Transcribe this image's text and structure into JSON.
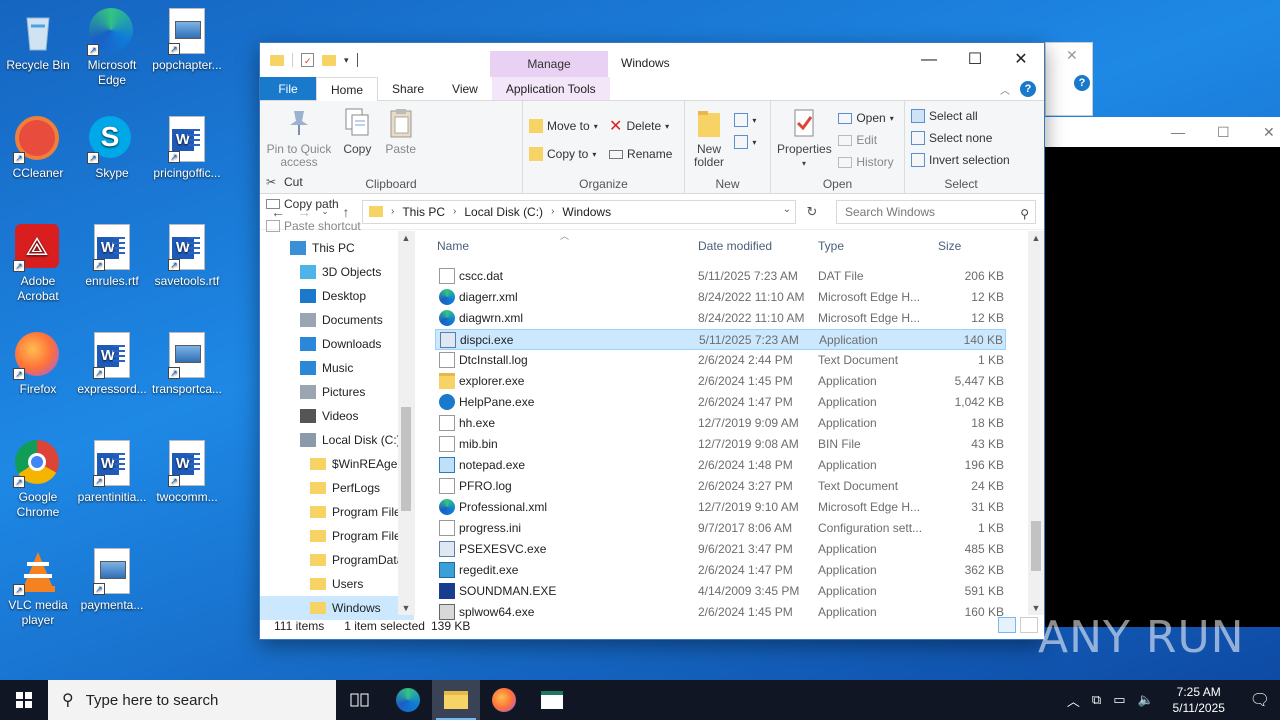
{
  "desktop": {
    "icons": [
      {
        "label": "Recycle Bin"
      },
      {
        "label": "Microsoft Edge"
      },
      {
        "label": "popchapter..."
      },
      {
        "label": "CCleaner"
      },
      {
        "label": "Skype"
      },
      {
        "label": "pricingoffic..."
      },
      {
        "label": "Adobe Acrobat"
      },
      {
        "label": "enrules.rtf"
      },
      {
        "label": "savetools.rtf"
      },
      {
        "label": "Firefox"
      },
      {
        "label": "expressord..."
      },
      {
        "label": "transportca..."
      },
      {
        "label": "Google Chrome"
      },
      {
        "label": "parentinitia..."
      },
      {
        "label": "twocomm..."
      },
      {
        "label": "VLC media player"
      },
      {
        "label": "paymenta..."
      }
    ]
  },
  "explorer": {
    "title": "Windows",
    "manage_tab": "Manage",
    "tabs": {
      "file": "File",
      "home": "Home",
      "share": "Share",
      "view": "View",
      "app_tools": "Application Tools"
    },
    "ribbon": {
      "clipboard": {
        "pin": "Pin to Quick access",
        "copy": "Copy",
        "paste": "Paste",
        "cut": "Cut",
        "copy_path": "Copy path",
        "paste_shortcut": "Paste shortcut",
        "label": "Clipboard"
      },
      "organize": {
        "move_to": "Move to",
        "copy_to": "Copy to",
        "delete": "Delete",
        "rename": "Rename",
        "label": "Organize"
      },
      "new": {
        "new_folder": "New folder",
        "label": "New"
      },
      "open": {
        "properties": "Properties",
        "open": "Open",
        "edit": "Edit",
        "history": "History",
        "label": "Open"
      },
      "select": {
        "select_all": "Select all",
        "select_none": "Select none",
        "invert": "Invert selection",
        "label": "Select"
      }
    },
    "address": {
      "crumbs": [
        "This PC",
        "Local Disk (C:)",
        "Windows"
      ],
      "search_placeholder": "Search Windows"
    },
    "nav_pane": [
      {
        "label": "This PC",
        "indent": 0,
        "selected": false
      },
      {
        "label": "3D Objects",
        "indent": 1,
        "selected": false
      },
      {
        "label": "Desktop",
        "indent": 1,
        "selected": false
      },
      {
        "label": "Documents",
        "indent": 1,
        "selected": false
      },
      {
        "label": "Downloads",
        "indent": 1,
        "selected": false
      },
      {
        "label": "Music",
        "indent": 1,
        "selected": false
      },
      {
        "label": "Pictures",
        "indent": 1,
        "selected": false
      },
      {
        "label": "Videos",
        "indent": 1,
        "selected": false
      },
      {
        "label": "Local Disk (C:)",
        "indent": 1,
        "selected": false
      },
      {
        "label": "$WinREAgent",
        "indent": 2,
        "selected": false
      },
      {
        "label": "PerfLogs",
        "indent": 2,
        "selected": false
      },
      {
        "label": "Program Files",
        "indent": 2,
        "selected": false
      },
      {
        "label": "Program Files",
        "indent": 2,
        "selected": false
      },
      {
        "label": "ProgramData",
        "indent": 2,
        "selected": false
      },
      {
        "label": "Users",
        "indent": 2,
        "selected": false
      },
      {
        "label": "Windows",
        "indent": 2,
        "selected": true
      }
    ],
    "columns": {
      "name": "Name",
      "date": "Date modified",
      "type": "Type",
      "size": "Size"
    },
    "files": [
      {
        "name": "cscc.dat",
        "date": "5/11/2025 7:23 AM",
        "type": "DAT File",
        "size": "206 KB",
        "icon": "file-icon"
      },
      {
        "name": "diagerr.xml",
        "date": "8/24/2022 11:10 AM",
        "type": "Microsoft Edge H...",
        "size": "12 KB",
        "icon": "edge-icon"
      },
      {
        "name": "diagwrn.xml",
        "date": "8/24/2022 11:10 AM",
        "type": "Microsoft Edge H...",
        "size": "12 KB",
        "icon": "edge-icon"
      },
      {
        "name": "dispci.exe",
        "date": "5/11/2025 7:23 AM",
        "type": "Application",
        "size": "140 KB",
        "icon": "exe-icon",
        "selected": true
      },
      {
        "name": "DtcInstall.log",
        "date": "2/6/2024 2:44 PM",
        "type": "Text Document",
        "size": "1 KB",
        "icon": "text-icon"
      },
      {
        "name": "explorer.exe",
        "date": "2/6/2024 1:45 PM",
        "type": "Application",
        "size": "5,447 KB",
        "icon": "folder-app-icon"
      },
      {
        "name": "HelpPane.exe",
        "date": "2/6/2024 1:47 PM",
        "type": "Application",
        "size": "1,042 KB",
        "icon": "help-icon"
      },
      {
        "name": "hh.exe",
        "date": "12/7/2019 9:09 AM",
        "type": "Application",
        "size": "18 KB",
        "icon": "hh-icon"
      },
      {
        "name": "mib.bin",
        "date": "12/7/2019 9:08 AM",
        "type": "BIN File",
        "size": "43 KB",
        "icon": "file-icon"
      },
      {
        "name": "notepad.exe",
        "date": "2/6/2024 1:48 PM",
        "type": "Application",
        "size": "196 KB",
        "icon": "notepad-icon"
      },
      {
        "name": "PFRO.log",
        "date": "2/6/2024 3:27 PM",
        "type": "Text Document",
        "size": "24 KB",
        "icon": "text-icon"
      },
      {
        "name": "Professional.xml",
        "date": "12/7/2019 9:10 AM",
        "type": "Microsoft Edge H...",
        "size": "31 KB",
        "icon": "edge-icon"
      },
      {
        "name": "progress.ini",
        "date": "9/7/2017 8:06 AM",
        "type": "Configuration sett...",
        "size": "1 KB",
        "icon": "ini-icon"
      },
      {
        "name": "PSEXESVC.exe",
        "date": "9/6/2021 3:47 PM",
        "type": "Application",
        "size": "485 KB",
        "icon": "exe-icon"
      },
      {
        "name": "regedit.exe",
        "date": "2/6/2024 1:47 PM",
        "type": "Application",
        "size": "362 KB",
        "icon": "regedit-icon"
      },
      {
        "name": "SOUNDMAN.EXE",
        "date": "4/14/2009 3:45 PM",
        "type": "Application",
        "size": "591 KB",
        "icon": "sound-icon"
      },
      {
        "name": "splwow64.exe",
        "date": "2/6/2024 1:45 PM",
        "type": "Application",
        "size": "160 KB",
        "icon": "printer-icon"
      }
    ],
    "status": {
      "items": "111 items",
      "selected": "1 item selected",
      "size": "139 KB"
    }
  },
  "taskbar": {
    "search_placeholder": "Type here to search",
    "time": "7:25 AM",
    "date": "5/11/2025"
  },
  "watermark": "ANY RUN"
}
